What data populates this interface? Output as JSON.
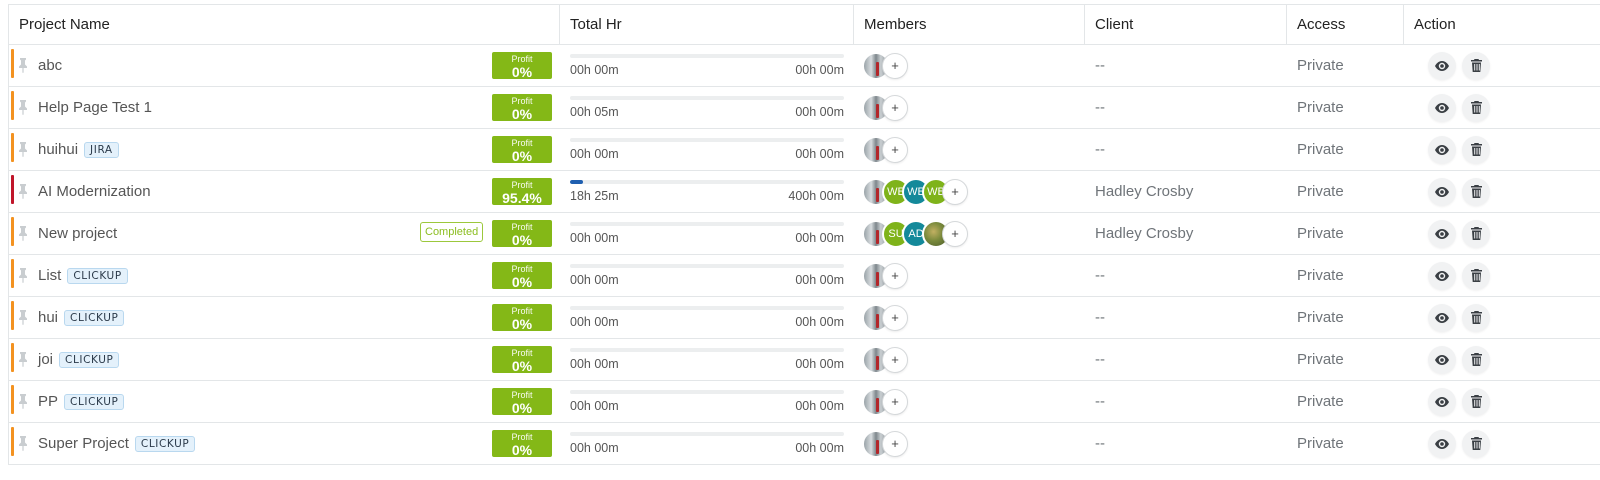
{
  "columns": {
    "name": "Project Name",
    "hours": "Total Hr",
    "members": "Members",
    "client": "Client",
    "access": "Access",
    "action": "Action"
  },
  "profit_label": "Profit",
  "add_member_label": "+",
  "colors": {
    "profit": "#84b817",
    "stripe_orange": "#f39220",
    "stripe_red": "#c0162a",
    "progress": "#1f5fb0"
  },
  "rows": [
    {
      "name": "abc",
      "tag": "",
      "status": "",
      "stripe": "orange",
      "profit": "0%",
      "spent": "00h 00m",
      "estimate": "00h 00m",
      "progress": 0,
      "members": [
        {
          "type": "photo",
          "initials": ""
        }
      ],
      "client": "--",
      "access": "Private"
    },
    {
      "name": "Help Page Test 1",
      "tag": "",
      "status": "",
      "stripe": "orange",
      "profit": "0%",
      "spent": "00h 05m",
      "estimate": "00h 00m",
      "progress": 0,
      "members": [
        {
          "type": "photo",
          "initials": ""
        }
      ],
      "client": "--",
      "access": "Private"
    },
    {
      "name": "huihui",
      "tag": "JIRA",
      "status": "",
      "stripe": "orange",
      "profit": "0%",
      "spent": "00h 00m",
      "estimate": "00h 00m",
      "progress": 0,
      "members": [
        {
          "type": "photo",
          "initials": ""
        }
      ],
      "client": "--",
      "access": "Private"
    },
    {
      "name": "AI Modernization",
      "tag": "",
      "status": "",
      "stripe": "red",
      "profit": "95.4%",
      "spent": "18h 25m",
      "estimate": "400h 00m",
      "progress": 0.046,
      "members": [
        {
          "type": "photo",
          "initials": ""
        },
        {
          "type": "green",
          "initials": "WE"
        },
        {
          "type": "teal",
          "initials": "WE"
        },
        {
          "type": "green",
          "initials": "WB"
        }
      ],
      "client": "Hadley Crosby",
      "access": "Private"
    },
    {
      "name": "New project",
      "tag": "",
      "status": "Completed",
      "stripe": "orange",
      "profit": "0%",
      "spent": "00h 00m",
      "estimate": "00h 00m",
      "progress": 0,
      "members": [
        {
          "type": "photo",
          "initials": ""
        },
        {
          "type": "green",
          "initials": "SU"
        },
        {
          "type": "teal",
          "initials": "AD"
        },
        {
          "type": "photo2",
          "initials": ""
        }
      ],
      "client": "Hadley Crosby",
      "access": "Private"
    },
    {
      "name": "List",
      "tag": "CLICKUP",
      "status": "",
      "stripe": "orange",
      "profit": "0%",
      "spent": "00h 00m",
      "estimate": "00h 00m",
      "progress": 0,
      "members": [
        {
          "type": "photo",
          "initials": ""
        }
      ],
      "client": "--",
      "access": "Private"
    },
    {
      "name": "hui",
      "tag": "CLICKUP",
      "status": "",
      "stripe": "orange",
      "profit": "0%",
      "spent": "00h 00m",
      "estimate": "00h 00m",
      "progress": 0,
      "members": [
        {
          "type": "photo",
          "initials": ""
        }
      ],
      "client": "--",
      "access": "Private"
    },
    {
      "name": "joi",
      "tag": "CLICKUP",
      "status": "",
      "stripe": "orange",
      "profit": "0%",
      "spent": "00h 00m",
      "estimate": "00h 00m",
      "progress": 0,
      "members": [
        {
          "type": "photo",
          "initials": ""
        }
      ],
      "client": "--",
      "access": "Private"
    },
    {
      "name": "PP",
      "tag": "CLICKUP",
      "status": "",
      "stripe": "orange",
      "profit": "0%",
      "spent": "00h 00m",
      "estimate": "00h 00m",
      "progress": 0,
      "members": [
        {
          "type": "photo",
          "initials": ""
        }
      ],
      "client": "--",
      "access": "Private"
    },
    {
      "name": "Super Project",
      "tag": "CLICKUP",
      "status": "",
      "stripe": "orange",
      "profit": "0%",
      "spent": "00h 00m",
      "estimate": "00h 00m",
      "progress": 0,
      "members": [
        {
          "type": "photo",
          "initials": ""
        }
      ],
      "client": "--",
      "access": "Private"
    }
  ]
}
